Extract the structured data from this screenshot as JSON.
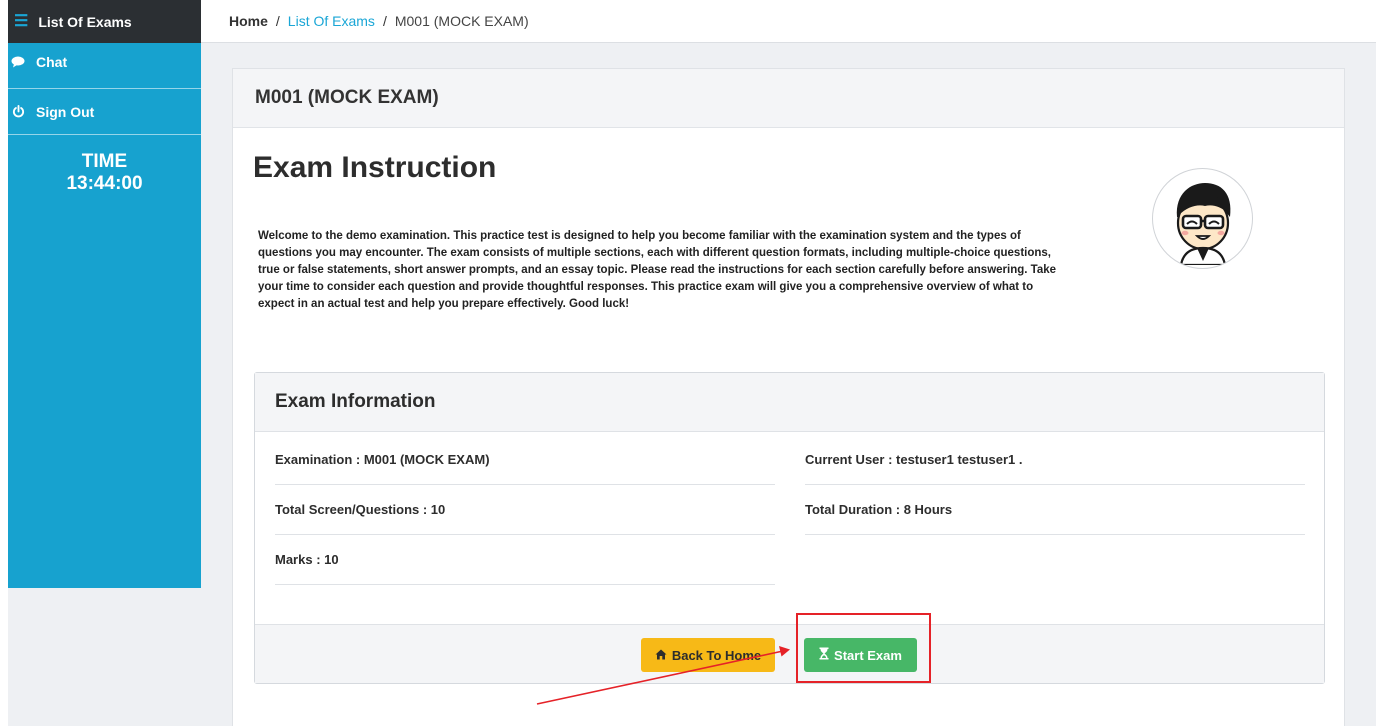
{
  "sidebar": {
    "list_of_exams": "List Of Exams",
    "chat": "Chat",
    "sign_out": "Sign Out",
    "time_label": "TIME",
    "time_value": "13:44:00"
  },
  "breadcrumb": {
    "home": "Home",
    "separator": "/",
    "list_of_exams": "List Of Exams",
    "current": "M001 (MOCK EXAM)"
  },
  "card": {
    "title": "M001 (MOCK EXAM)",
    "heading": "Exam Instruction",
    "welcome_text": "Welcome to the demo examination. This practice test is designed to help you become familiar with the examination system and the types of questions you may encounter. The exam consists of multiple sections, each with different question formats, including multiple-choice questions, true or false statements, short answer prompts, and an essay topic. Please read the instructions for each section carefully before answering. Take your time to consider each question and provide thoughtful responses. This practice exam will give you a comprehensive overview of what to expect in an actual test and help you prepare effectively. Good luck!"
  },
  "exam_info": {
    "title": "Exam Information",
    "examination": "Examination : M001 (MOCK EXAM)",
    "total_questions": "Total Screen/Questions : 10",
    "marks": "Marks : 10",
    "current_user": "Current User : testuser1 testuser1 .",
    "total_duration": "Total Duration : 8 Hours"
  },
  "buttons": {
    "back_home": "Back To Home",
    "start_exam": "Start Exam"
  },
  "colors": {
    "sidebar": "#17a2cf",
    "sidebar_top": "#2b2f33",
    "link": "#1aa6d6",
    "back_button": "#f7b917",
    "start_button": "#47b767",
    "annotation": "#e52228"
  },
  "icons": {
    "list": "list-icon",
    "chat": "chat-bubble-icon",
    "sign_out": "power-icon",
    "home": "home-icon",
    "start": "hourglass-icon"
  }
}
